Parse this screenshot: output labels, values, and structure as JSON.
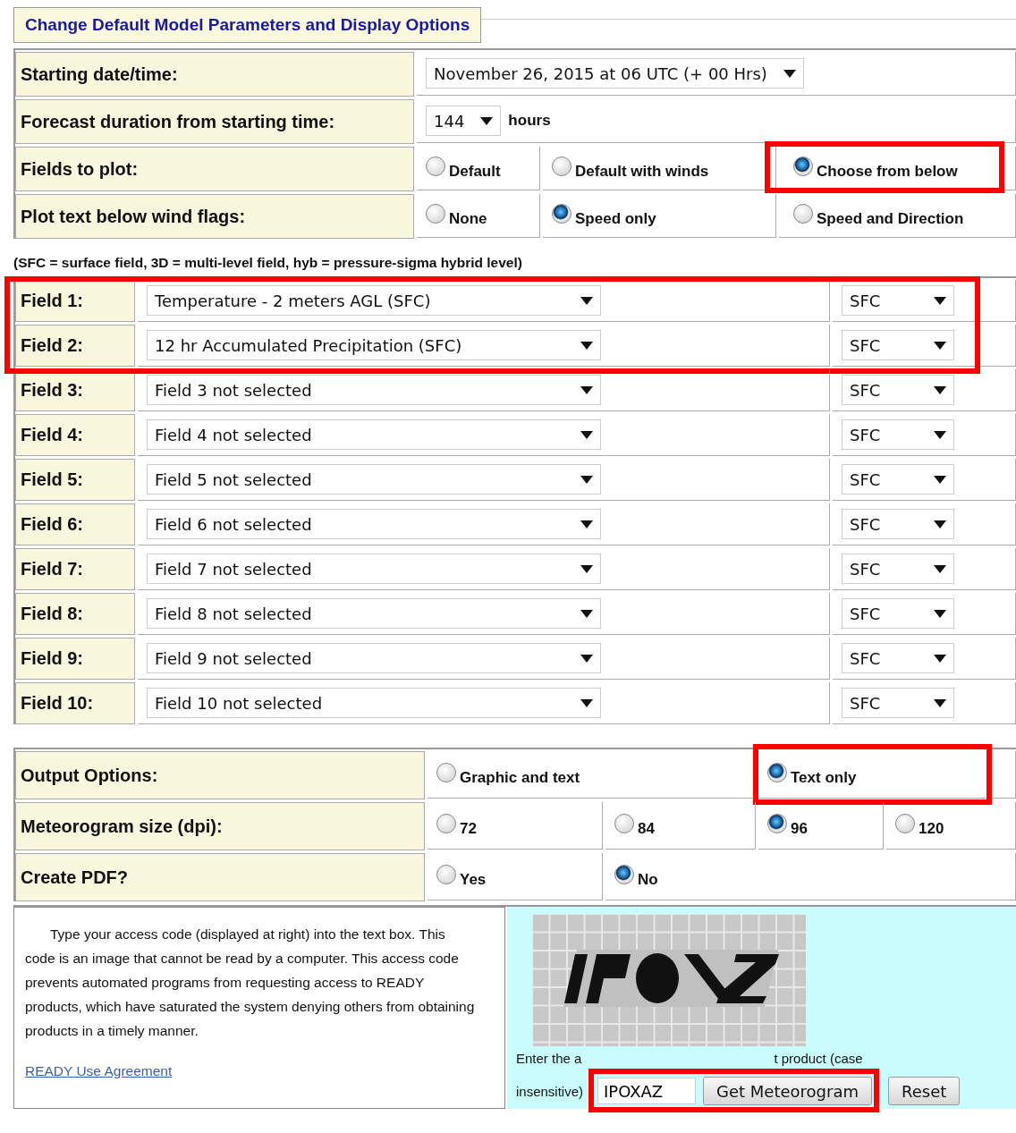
{
  "header": {
    "title": "Change Default Model Parameters and Display Options"
  },
  "settings": [
    {
      "kind": "select",
      "label": "Starting date/time:",
      "value": "November 26, 2015 at 06 UTC (+ 00 Hrs)"
    },
    {
      "kind": "select",
      "label": "Forecast duration from starting time:",
      "value": "144",
      "unit": "hours"
    },
    {
      "kind": "radio",
      "label": "Fields to plot:",
      "options": [
        {
          "label": "Default",
          "selected": false,
          "highlighted": false
        },
        {
          "label": "Default with winds",
          "selected": false,
          "highlighted": false
        },
        {
          "label": "Choose from below",
          "selected": true,
          "highlighted": true
        }
      ]
    },
    {
      "kind": "radio",
      "label": "Plot text below wind flags:",
      "options": [
        {
          "label": "None",
          "selected": false,
          "highlighted": false
        },
        {
          "label": "Speed only",
          "selected": true,
          "highlighted": false
        },
        {
          "label": "Speed and Direction",
          "selected": false,
          "highlighted": false
        }
      ]
    }
  ],
  "note": "(SFC = surface field, 3D = multi-level field, hyb = pressure-sigma hybrid level)",
  "fields": [
    {
      "label": "Field 1:",
      "value": "Temperature - 2 meters AGL (SFC)",
      "vertical_level": "SFC",
      "highlighted": true
    },
    {
      "label": "Field 2:",
      "value": "12 hr Accumulated Precipitation (SFC)",
      "vertical_level": "SFC",
      "highlighted": true
    },
    {
      "label": "Field 3:",
      "value": "Field 3 not selected",
      "vertical_level": "SFC",
      "highlighted": false
    },
    {
      "label": "Field 4:",
      "value": "Field 4 not selected",
      "vertical_level": "SFC",
      "highlighted": false
    },
    {
      "label": "Field 5:",
      "value": "Field 5 not selected",
      "vertical_level": "SFC",
      "highlighted": false
    },
    {
      "label": "Field 6:",
      "value": "Field 6 not selected",
      "vertical_level": "SFC",
      "highlighted": false
    },
    {
      "label": "Field 7:",
      "value": "Field 7 not selected",
      "vertical_level": "SFC",
      "highlighted": false
    },
    {
      "label": "Field 8:",
      "value": "Field 8 not selected",
      "vertical_level": "SFC",
      "highlighted": false
    },
    {
      "label": "Field 9:",
      "value": "Field 9 not selected",
      "vertical_level": "SFC",
      "highlighted": false
    },
    {
      "label": "Field 10:",
      "value": "Field 10 not selected",
      "vertical_level": "SFC",
      "highlighted": false
    }
  ],
  "output": [
    {
      "label": "Output Options:",
      "options": [
        {
          "label": "Graphic and text",
          "selected": false,
          "highlighted": false
        },
        {
          "label": "Text only",
          "selected": true,
          "highlighted": true
        }
      ]
    },
    {
      "label": "Meteorogram size (dpi):",
      "options": [
        {
          "label": "72",
          "selected": false,
          "highlighted": false
        },
        {
          "label": "84",
          "selected": false,
          "highlighted": false
        },
        {
          "label": "96",
          "selected": true,
          "highlighted": false
        },
        {
          "label": "120",
          "selected": false,
          "highlighted": false
        }
      ]
    },
    {
      "label": "Create PDF?",
      "options": [
        {
          "label": "Yes",
          "selected": false,
          "highlighted": false
        },
        {
          "label": "No",
          "selected": true,
          "highlighted": false
        }
      ]
    }
  ],
  "access": {
    "instructions": "Type your access code (displayed at right) into the text box. This code is an image that cannot be read by a computer. This access code prevents automated programs from requesting access to READY products, which have saturated the system denying others from obtaining products in a timely manner.",
    "link": "READY Use Agreement",
    "captcha": {
      "kind": "picture"
    },
    "prompt_parts": [
      "Enter the a",
      "t product (case",
      "insensitive)"
    ],
    "code": {
      "value": "IPOXAZ",
      "highlighted": true
    },
    "buttons": [
      {
        "label": "Get Meteorogram",
        "highlighted": true
      },
      {
        "label": "Reset",
        "highlighted": false
      }
    ]
  }
}
